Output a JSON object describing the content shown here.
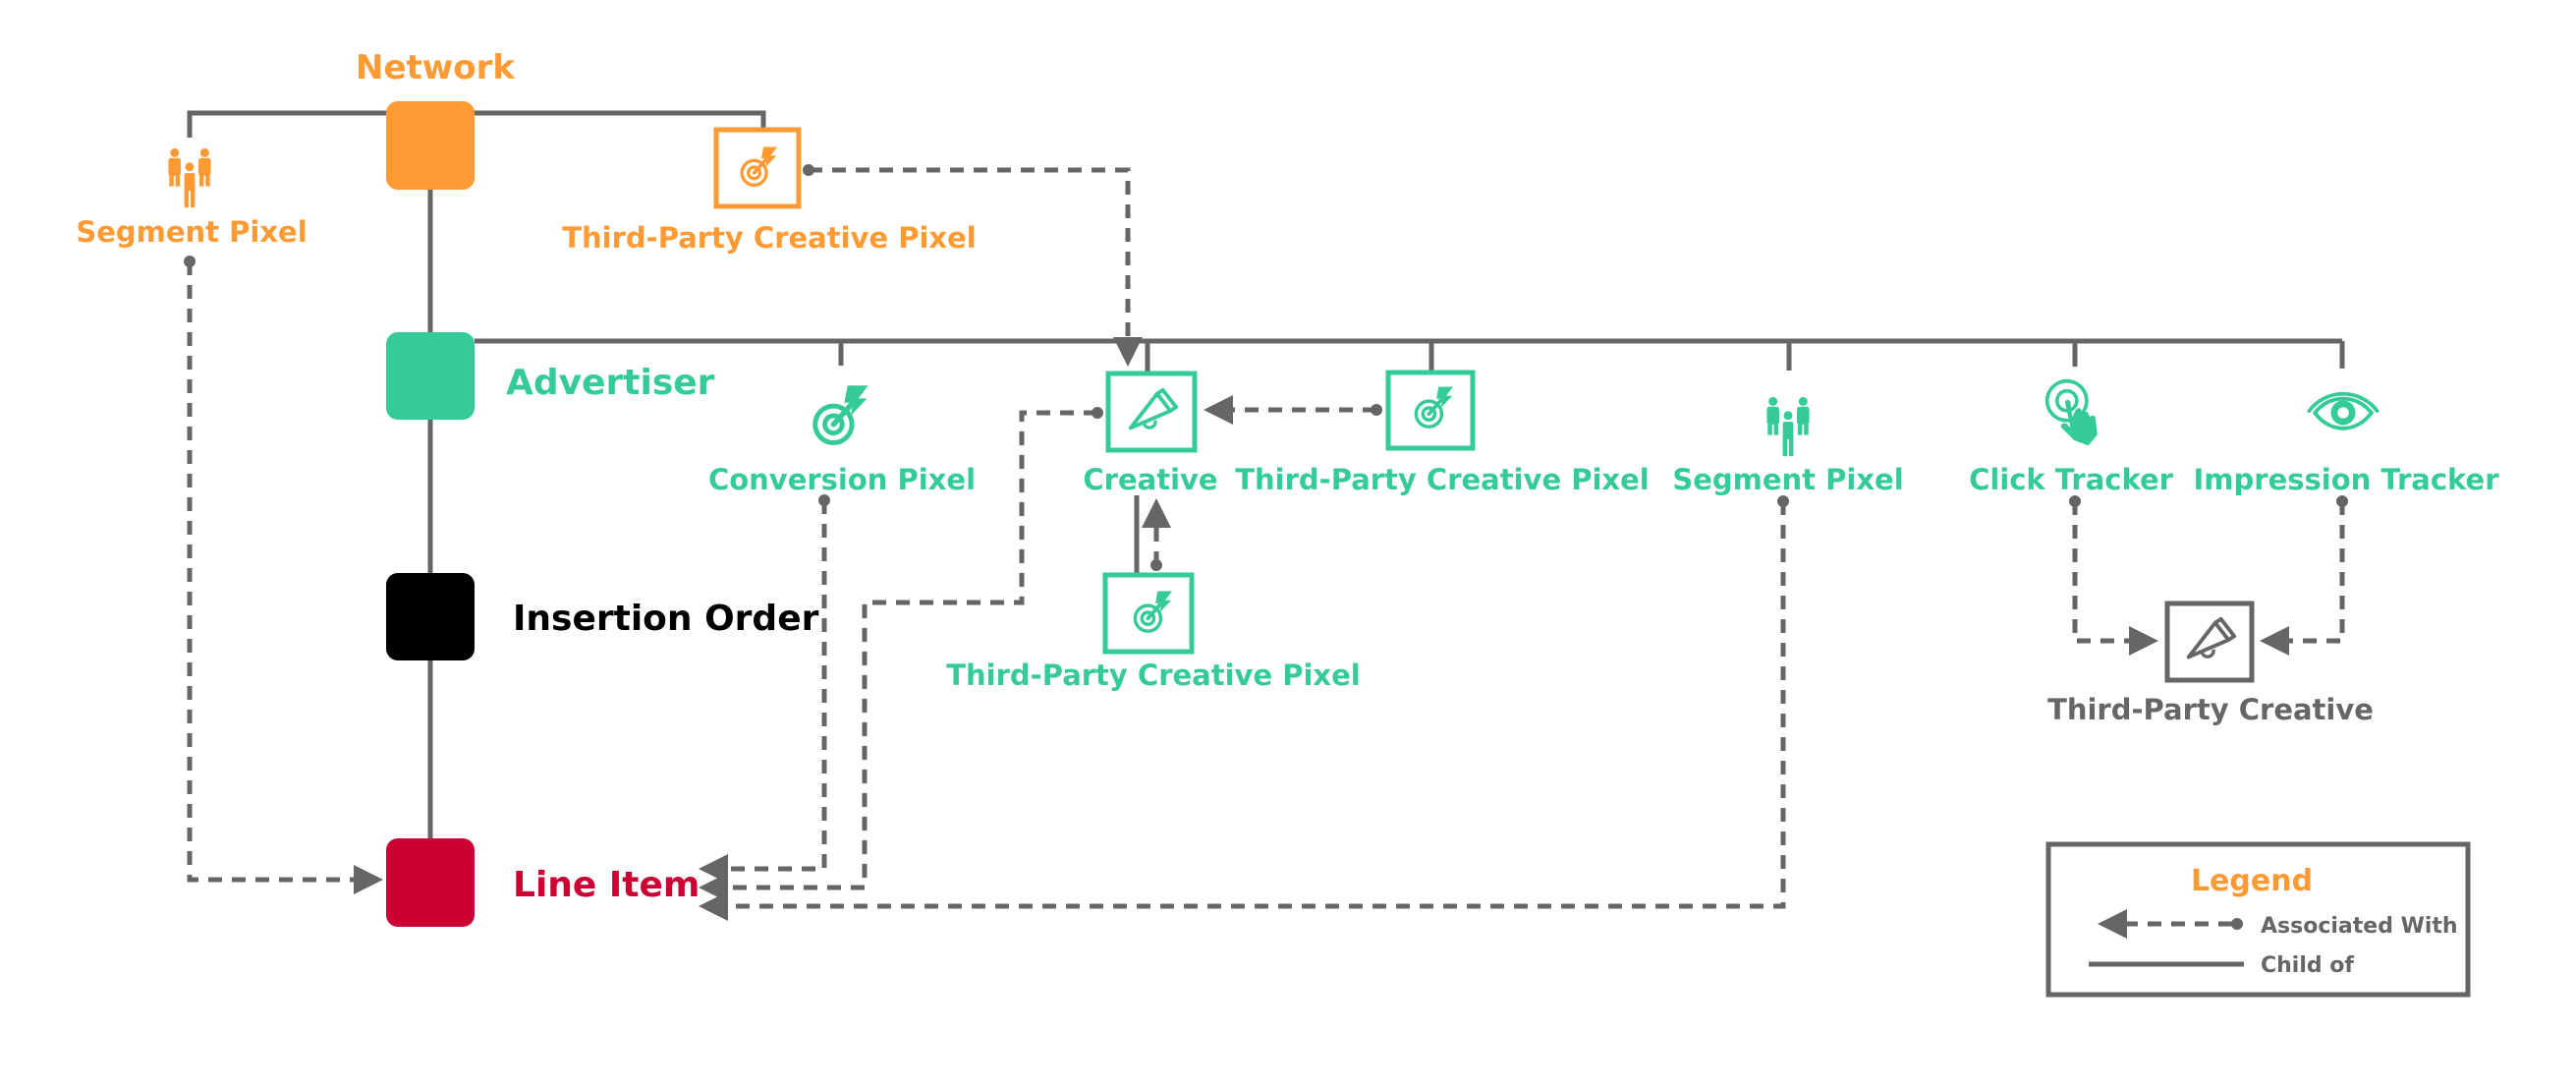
{
  "colors": {
    "network": "#fd9a33",
    "advertiser": "#34cb97",
    "insertion_order": "#000000",
    "line_item": "#cb0033",
    "connector": "#666666",
    "third_party": "#666666",
    "legend_title": "#fd9a33"
  },
  "hierarchy": {
    "network": {
      "label": "Network"
    },
    "advertiser": {
      "label": "Advertiser"
    },
    "insertion_order": {
      "label": "Insertion Order"
    },
    "line_item": {
      "label": "Line Item"
    }
  },
  "network_children": {
    "segment_pixel": {
      "label": "Segment Pixel",
      "icon": "people-group-icon"
    },
    "third_party_creative_pixel": {
      "label": "Third-Party Creative Pixel",
      "icon": "target-lightning-icon"
    }
  },
  "advertiser_children": {
    "conversion_pixel": {
      "label": "Conversion Pixel",
      "icon": "target-lightning-icon"
    },
    "creative": {
      "label": "Creative",
      "icon": "megaphone-icon"
    },
    "third_party_creative_pixel": {
      "label": "Third-Party Creative Pixel",
      "icon": "target-lightning-icon"
    },
    "segment_pixel": {
      "label": "Segment Pixel",
      "icon": "people-group-icon"
    },
    "click_tracker": {
      "label": "Click Tracker",
      "icon": "hand-tap-icon"
    },
    "impression_tracker": {
      "label": "Impression Tracker",
      "icon": "eye-icon"
    }
  },
  "creative_children": {
    "third_party_creative_pixel": {
      "label": "Third-Party Creative Pixel",
      "icon": "target-lightning-icon"
    }
  },
  "standalone": {
    "third_party_creative": {
      "label": "Third-Party Creative",
      "icon": "megaphone-icon"
    }
  },
  "associations": [
    {
      "from": "Network Segment Pixel",
      "to": "Line Item"
    },
    {
      "from": "Network Third-Party Creative Pixel",
      "to": "Creative"
    },
    {
      "from": "Advertiser Third-Party Creative Pixel",
      "to": "Creative"
    },
    {
      "from": "Creative Third-Party Creative Pixel",
      "to": "Creative"
    },
    {
      "from": "Conversion Pixel",
      "to": "Line Item"
    },
    {
      "from": "Creative",
      "to": "Line Item"
    },
    {
      "from": "Advertiser Segment Pixel",
      "to": "Line Item"
    },
    {
      "from": "Click Tracker",
      "to": "Third-Party Creative"
    },
    {
      "from": "Impression Tracker",
      "to": "Third-Party Creative"
    }
  ],
  "legend": {
    "title": "Legend",
    "items": [
      {
        "label": "Associated With",
        "style": "dashed-arrow"
      },
      {
        "label": "Child of",
        "style": "solid"
      }
    ]
  }
}
